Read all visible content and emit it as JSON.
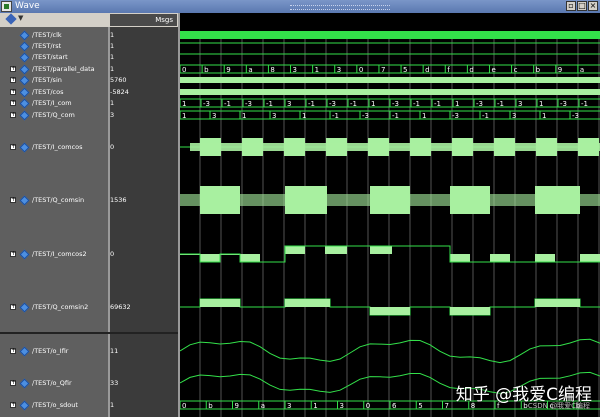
{
  "window": {
    "title": "Wave"
  },
  "value_header": "Msgs",
  "signals": [
    {
      "name": "/TEST/clk",
      "value": "1",
      "expandable": false
    },
    {
      "name": "/TEST/rst",
      "value": "1",
      "expandable": false
    },
    {
      "name": "/TEST/start",
      "value": "1",
      "expandable": false
    },
    {
      "name": "/TEST/parallel_data",
      "value": "1",
      "expandable": true
    },
    {
      "name": "/TEST/sin",
      "value": "5760",
      "expandable": true
    },
    {
      "name": "/TEST/cos",
      "value": "-5824",
      "expandable": true
    },
    {
      "name": "/TEST/I_com",
      "value": "1",
      "expandable": true
    },
    {
      "name": "/TEST/Q_com",
      "value": "3",
      "expandable": true
    },
    {
      "name": "/TEST/I_comcos",
      "value": "0",
      "expandable": true
    },
    {
      "name": "/TEST/Q_comsin",
      "value": "1536",
      "expandable": true
    },
    {
      "name": "/TEST/I_comcos2",
      "value": "0",
      "expandable": true
    },
    {
      "name": "/TEST/Q_comsin2",
      "value": "69632",
      "expandable": true
    },
    {
      "name": "/TEST/o_Ifir",
      "value": "11",
      "expandable": true
    },
    {
      "name": "/TEST/o_Qfir",
      "value": "33",
      "expandable": true
    },
    {
      "name": "/TEST/o_sdout",
      "value": "1",
      "expandable": true
    }
  ],
  "waveform": {
    "colors": {
      "wave": "#33e04a",
      "fill": "#a8f0a0",
      "cursor_line": "#8a8a8a",
      "background": "#000000"
    },
    "parallel_data_labels": [
      "0",
      "b",
      "9",
      "a",
      "8",
      "3",
      "1",
      "3",
      "0",
      "7",
      "5",
      "d",
      "f",
      "d",
      "e",
      "c",
      "b",
      "9",
      "a"
    ],
    "I_com_labels": [
      "1",
      "-3",
      "-1",
      "-3",
      "-1",
      "3",
      "-1",
      "-3",
      "-1",
      "1",
      "-3",
      "-1",
      "-1",
      "1",
      "-3",
      "-1",
      "3",
      "1",
      "-3",
      "-1"
    ],
    "Q_com_labels": [
      "1",
      "3",
      "1",
      "3",
      "1",
      "-1",
      "-3",
      "-1",
      "1",
      "-3",
      "-1",
      "3",
      "1",
      "-3"
    ],
    "o_sdout_labels": [
      "0",
      "b",
      "9",
      "a",
      "3",
      "1",
      "3",
      "0",
      "6",
      "5",
      "7",
      "8",
      "f",
      "b",
      "c",
      "b"
    ]
  },
  "watermark": {
    "main": "知乎 @我爱C编程",
    "sub": "CSDN @我爱C编程"
  }
}
